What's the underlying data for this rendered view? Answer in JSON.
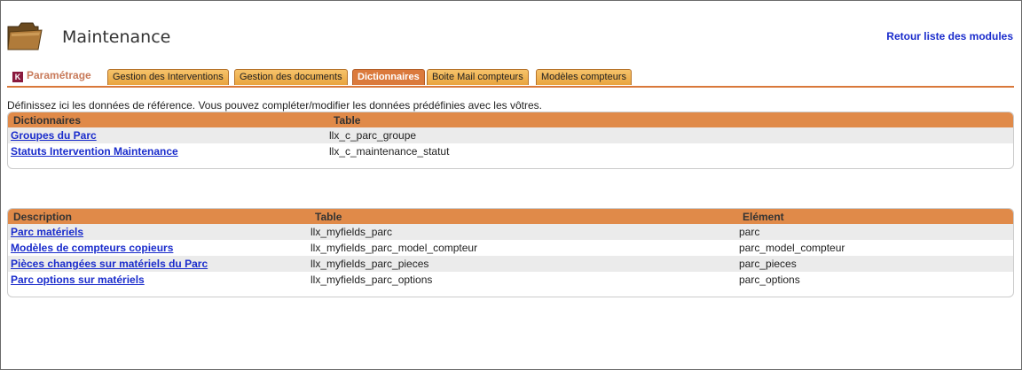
{
  "header": {
    "title": "Maintenance",
    "back_link": "Retour liste des modules"
  },
  "tabs": {
    "setup_label": "Paramétrage",
    "items": [
      {
        "label": "Gestion des Interventions",
        "active": false
      },
      {
        "label": "Gestion des documents",
        "active": false
      },
      {
        "label": "Dictionnaires",
        "active": true
      },
      {
        "label": "Boite Mail compteurs",
        "active": false
      },
      {
        "label": "Modèles compteurs",
        "active": false
      }
    ]
  },
  "intro": "Définissez ici les données de référence. Vous pouvez compléter/modifier les données prédéfinies avec les vôtres.",
  "dictionaries": {
    "headers": [
      "Dictionnaires",
      "Table"
    ],
    "rows": [
      {
        "name": "Groupes du Parc",
        "table": "llx_c_parc_groupe"
      },
      {
        "name": "Statuts Intervention Maintenance",
        "table": "llx_c_maintenance_statut"
      }
    ]
  },
  "extrafields": {
    "headers": [
      "Description",
      "Table",
      "Elément"
    ],
    "rows": [
      {
        "name": "Parc matériels",
        "table": "llx_myfields_parc",
        "element": "parc"
      },
      {
        "name": "Modèles de compteurs copieurs",
        "table": "llx_myfields_parc_model_compteur",
        "element": "parc_model_compteur"
      },
      {
        "name": "Pièces changées sur matériels du Parc",
        "table": "llx_myfields_parc_pieces",
        "element": "parc_pieces"
      },
      {
        "name": "Parc options sur matériels",
        "table": "llx_myfields_parc_options",
        "element": "parc_options"
      }
    ]
  },
  "colors": {
    "accent": "#e08a49",
    "link": "#1a2ccc",
    "tab_active": "#db7a3c",
    "tab_inactive": "#f0b455"
  }
}
